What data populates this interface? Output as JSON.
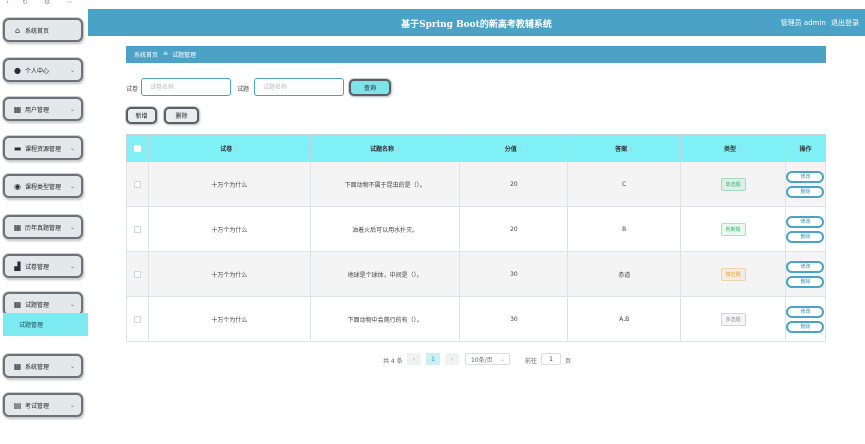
{
  "browser": {
    "icons": [
      "back-icon",
      "refresh-icon",
      "settings-icon",
      "more-icon"
    ]
  },
  "header": {
    "title": "基于Spring Boot的新高考教辅系统",
    "user_label": "管理员 admin",
    "logout": "退出登录"
  },
  "sidebar": {
    "items": [
      {
        "label": "系统首页",
        "icon": "home-icon",
        "has_chevron": false
      },
      {
        "label": "个人中心",
        "icon": "user-icon",
        "has_chevron": true
      },
      {
        "label": "用户管理",
        "icon": "grid-icon",
        "has_chevron": true
      },
      {
        "label": "课程资源管理",
        "icon": "monitor-icon",
        "has_chevron": true
      },
      {
        "label": "课程类型管理",
        "icon": "location-icon",
        "has_chevron": true
      },
      {
        "label": "历年真题管理",
        "icon": "grid-icon",
        "has_chevron": true
      },
      {
        "label": "试卷管理",
        "icon": "chart-icon",
        "has_chevron": true
      },
      {
        "label": "试题管理",
        "icon": "grid-icon",
        "has_chevron": true
      },
      {
        "label": "系统管理",
        "icon": "grid-icon",
        "has_chevron": true
      },
      {
        "label": "考试管理",
        "icon": "calendar-icon",
        "has_chevron": true
      }
    ],
    "active_sub": "试题管理"
  },
  "breadcrumb": {
    "home": "系统首页",
    "sep": "≡",
    "current": "试题管理"
  },
  "search": {
    "paper_label": "试卷",
    "paper_placeholder": "试卷名称",
    "question_label": "试题",
    "question_placeholder": "试题名称",
    "query_button": "查询"
  },
  "actions": {
    "add": "新增",
    "delete": "删除"
  },
  "table": {
    "columns": [
      "试卷",
      "试题名称",
      "分值",
      "答案",
      "类型",
      "操作"
    ],
    "rows": [
      {
        "paper": "十万个为什么",
        "question": "下面动物不属于昆虫的是（）。",
        "score": "20",
        "answer": "C",
        "type": "单选题",
        "type_color": "#2fb866"
      },
      {
        "paper": "十万个为什么",
        "question": "油着火后可以用水扑灭。",
        "score": "20",
        "answer": "B",
        "type": "判断题",
        "type_color": "#2fb866"
      },
      {
        "paper": "十万个为什么",
        "question": "地球是个球体，中间是（）。",
        "score": "30",
        "answer": "赤道",
        "type": "填空题",
        "type_color": "#e6a23c"
      },
      {
        "paper": "十万个为什么",
        "question": "下面动物中会爬行的有（）。",
        "score": "30",
        "answer": "A,B",
        "type": "多选题",
        "type_color": "#909399"
      }
    ],
    "edit_label": "修改",
    "delete_label": "删除"
  },
  "pagination": {
    "total_text": "共 4 条",
    "prev": "‹",
    "current_page": "1",
    "next": "›",
    "page_size": "10条/页",
    "goto_label": "前往",
    "goto_value": "1",
    "page_unit": "页"
  }
}
